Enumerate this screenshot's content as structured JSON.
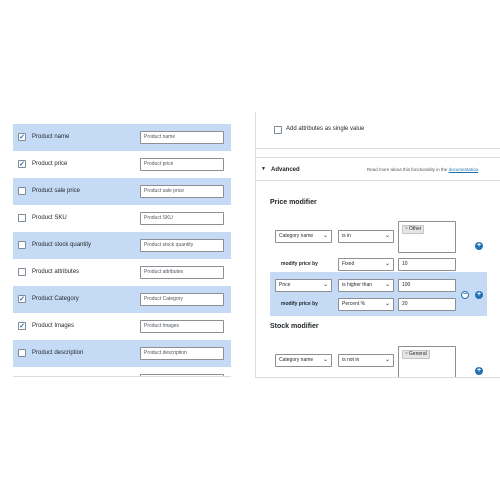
{
  "fields": [
    {
      "label": "Product name",
      "input": "Product name",
      "checked": true
    },
    {
      "label": "Product price",
      "input": "Product price",
      "checked": true
    },
    {
      "label": "Product sale price",
      "input": "Product sale price",
      "checked": false
    },
    {
      "label": "Product SKU",
      "input": "Product SKU",
      "checked": false
    },
    {
      "label": "Product stock quantity",
      "input": "Product stock quantity",
      "checked": false
    },
    {
      "label": "Product attributes",
      "input": "Product attributes",
      "checked": false
    },
    {
      "label": "Product Category",
      "input": "Product Category",
      "checked": true
    },
    {
      "label": "Product Images",
      "input": "Product Images",
      "checked": true
    },
    {
      "label": "Product description",
      "input": "Product description",
      "checked": false
    }
  ],
  "single_value": {
    "label": "Add attributes as single value",
    "checked": false
  },
  "advanced": {
    "arrow": "▼",
    "title": "Advanced",
    "help_text": "Read more about this functionality in the ",
    "help_link": "documentation",
    "help_end": "."
  },
  "price_modifier": {
    "title": "Price modifier",
    "rule1": {
      "field": "Category name",
      "operator": "is in",
      "tag": "Other",
      "modify_label": "modify price by",
      "mode": "Fixed",
      "amount": "10"
    },
    "rule2": {
      "field": "Price",
      "operator": "is higher than",
      "value": "100",
      "modify_label": "modify price by",
      "mode": "Percent %",
      "amount": "20"
    }
  },
  "stock_modifier": {
    "title": "Stock modifier",
    "rule1": {
      "field": "Category name",
      "operator": "is not in",
      "tag": "General"
    }
  },
  "icons": {
    "check": "✓",
    "chevron": "⌄",
    "tag_remove": "×",
    "plus": "+",
    "minus": "−"
  },
  "colors": {
    "accent": "#2271b1",
    "row_highlight": "#c5dbf5"
  }
}
